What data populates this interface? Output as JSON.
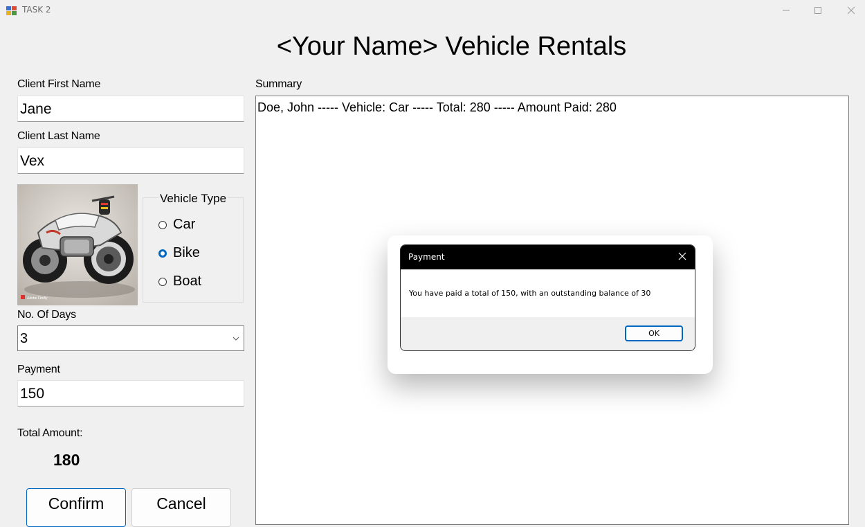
{
  "window": {
    "title": "TASK 2"
  },
  "heading": "<Your Name> Vehicle Rentals",
  "form": {
    "first_name_label": "Client First Name",
    "first_name_value": "Jane",
    "last_name_label": "Client Last Name",
    "last_name_value": "Vex",
    "vehicle_type": {
      "legend": "Vehicle Type",
      "options": [
        {
          "label": "Car",
          "checked": false
        },
        {
          "label": "Bike",
          "checked": true
        },
        {
          "label": "Boat",
          "checked": false
        }
      ]
    },
    "image_watermark": "Adobe Firefly",
    "days_label": "No. Of Days",
    "days_value": "3",
    "payment_label": "Payment",
    "payment_value": "150",
    "total_label": "Total Amount:",
    "total_value": "180",
    "confirm_label": "Confirm",
    "cancel_label": "Cancel"
  },
  "summary": {
    "label": "Summary",
    "lines": [
      "Doe, John ----- Vehicle: Car ----- Total: 280 ----- Amount Paid: 280"
    ]
  },
  "dialog": {
    "title": "Payment",
    "message": "You have paid a total of 150, with an outstanding balance of 30",
    "ok_label": "OK"
  },
  "colors": {
    "accent": "#0067c0",
    "window_bg": "#f0f0f0",
    "dialog_titlebar": "#000000"
  }
}
